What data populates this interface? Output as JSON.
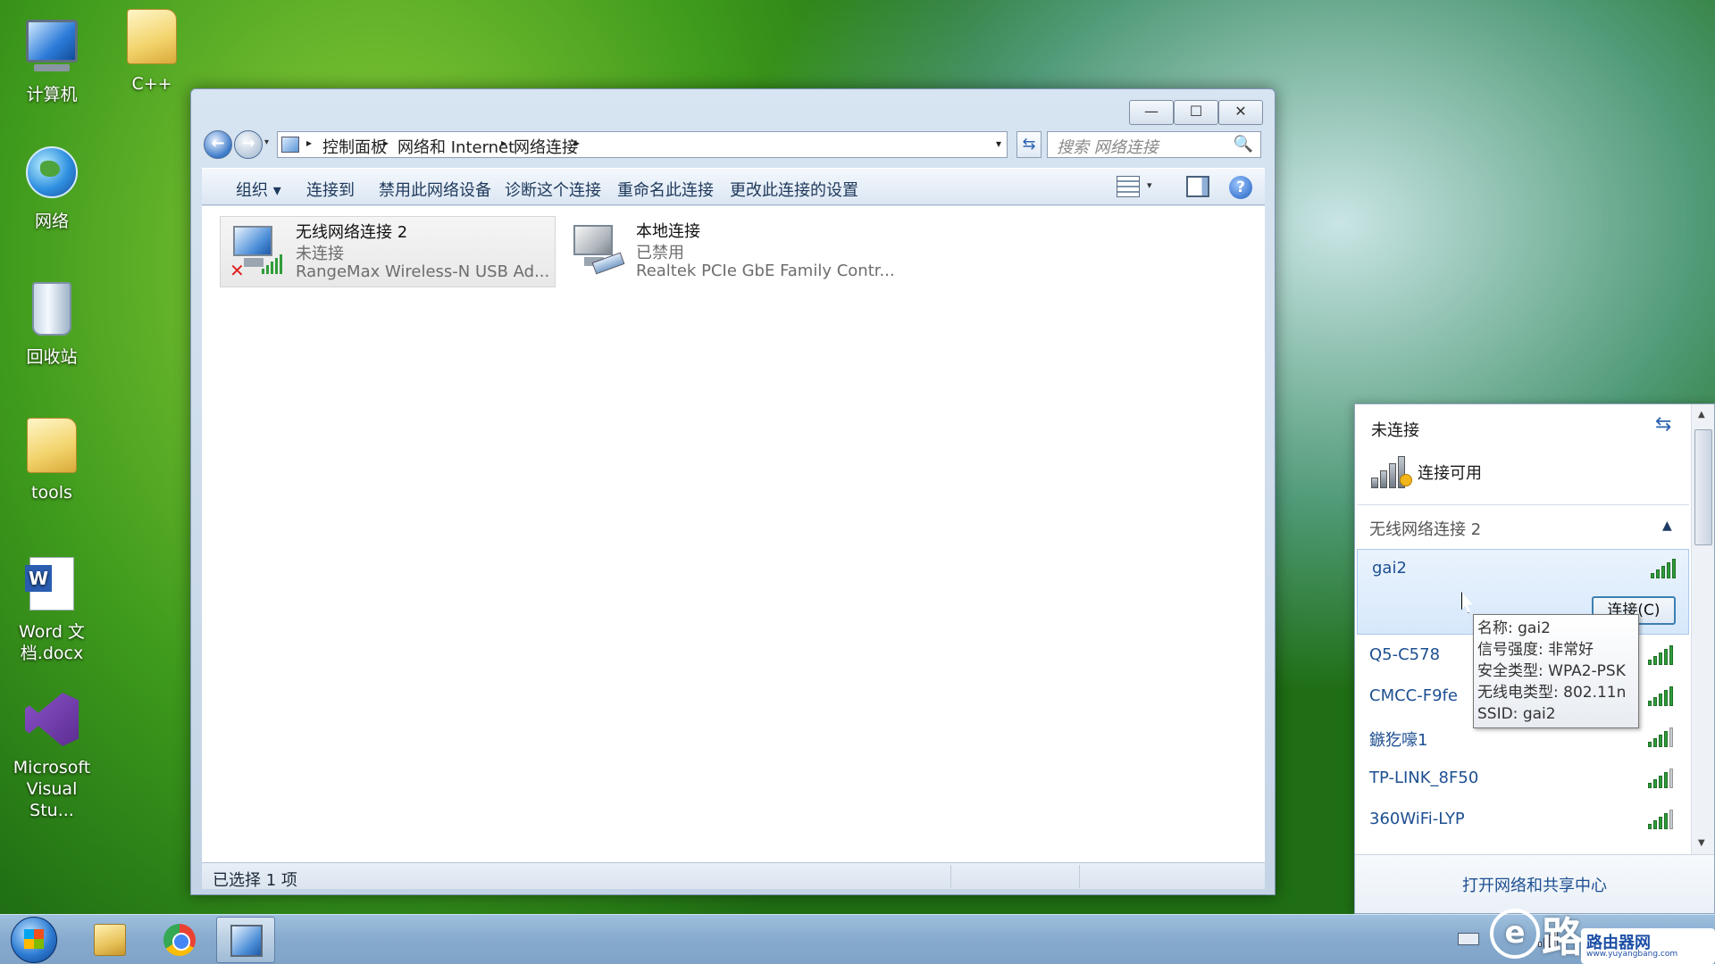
{
  "desktop": {
    "icons": [
      {
        "label": "计算机"
      },
      {
        "label": "C++"
      },
      {
        "label": "网络"
      },
      {
        "label": "回收站"
      },
      {
        "label": "tools"
      },
      {
        "label": "Word 文档.docx"
      },
      {
        "label": "Microsoft Visual Stu..."
      }
    ]
  },
  "window": {
    "controls": {
      "minimize": "—",
      "maximize": "☐",
      "close": "✕"
    },
    "nav": {
      "back": "←",
      "forward": "→",
      "history": "▾"
    },
    "breadcrumb": [
      "控制面板",
      "网络和 Internet",
      "网络连接"
    ],
    "breadcrumb_sep": "▸",
    "address_dropdown": "▾",
    "refresh": "⇆",
    "search": {
      "placeholder": "搜索 网络连接",
      "icon": "🔍"
    },
    "toolbar": {
      "organize": "组织 ▾",
      "connect_to": "连接到",
      "disable_device": "禁用此网络设备",
      "diagnose": "诊断这个连接",
      "rename": "重命名此连接",
      "change_settings": "更改此连接的设置",
      "view_dropdown": "▾",
      "help": "?"
    },
    "connections": [
      {
        "name": "无线网络连接 2",
        "status": "未连接",
        "device": "RangeMax Wireless-N USB Ad...",
        "error_mark": "✕",
        "selected": true
      },
      {
        "name": "本地连接",
        "status": "已禁用",
        "device": "Realtek PCIe GbE Family Contr...",
        "selected": false
      }
    ],
    "statusbar": {
      "text": "已选择 1 项"
    }
  },
  "flyout": {
    "title": "未连接",
    "refresh": "⇆",
    "availability": "连接可用",
    "section": "无线网络连接 2",
    "collapse": "▲",
    "networks": [
      {
        "name": "gai2",
        "signal_bars": 5
      },
      {
        "name": "Q5-C578",
        "signal_bars": 5
      },
      {
        "name": "CMCC-F9fe",
        "signal_bars": 5
      },
      {
        "name": "鏃犵嚎1",
        "signal_bars": 4
      },
      {
        "name": "TP-LINK_8F50",
        "signal_bars": 4
      },
      {
        "name": "360WiFi-LYP",
        "signal_bars": 4
      }
    ],
    "connect_button": "连接(C)",
    "scroll_up": "▲",
    "scroll_down": "▼",
    "footer_link": "打开网络和共享中心"
  },
  "tooltip": {
    "lines": [
      "名称: gai2",
      "信号强度: 非常好",
      "安全类型: WPA2-PSK",
      "无线电类型: 802.11n",
      "SSID: gai2"
    ]
  },
  "watermark": {
    "badge": "e",
    "big": "路",
    "cn": "路由器网",
    "url": "www.yuyangbang.com"
  }
}
